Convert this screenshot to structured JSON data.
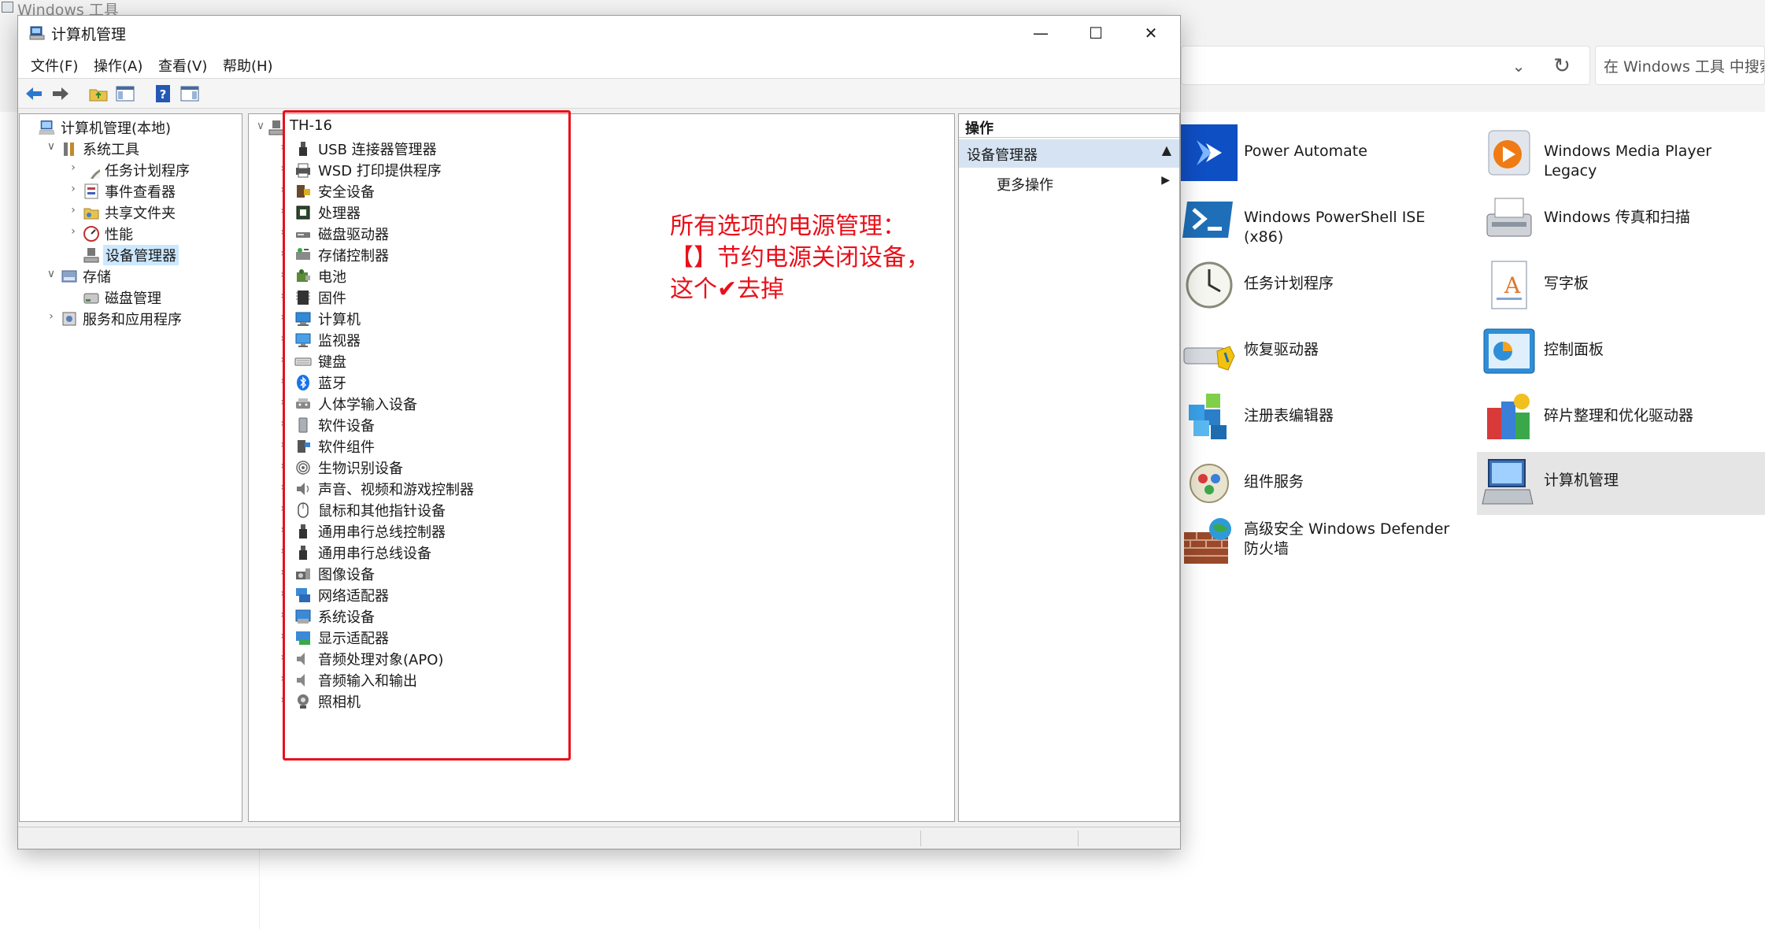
{
  "background_window": {
    "title": "Windows 工具",
    "search_placeholder": "在 Windows 工具 中搜索",
    "tools": [
      {
        "label": "Power Automate",
        "icon": "power-automate-icon"
      },
      {
        "label": "Windows Media Player Legacy",
        "icon": "media-player-icon"
      },
      {
        "label": "Windows PowerShell ISE (x86)",
        "icon": "powershell-icon"
      },
      {
        "label": "Windows 传真和扫描",
        "icon": "fax-scan-icon"
      },
      {
        "label": "任务计划程序",
        "icon": "clock-icon"
      },
      {
        "label": "写字板",
        "icon": "wordpad-icon"
      },
      {
        "label": "恢复驱动器",
        "icon": "recovery-drive-icon"
      },
      {
        "label": "控制面板",
        "icon": "control-panel-icon"
      },
      {
        "label": "注册表编辑器",
        "icon": "registry-icon"
      },
      {
        "label": "碎片整理和优化驱动器",
        "icon": "defrag-icon"
      },
      {
        "label": "组件服务",
        "icon": "component-services-icon"
      },
      {
        "label": "计算机管理",
        "icon": "computer-management-icon",
        "selected": true
      },
      {
        "label": "高级安全 Windows Defender 防火墙",
        "icon": "firewall-icon"
      }
    ]
  },
  "window": {
    "title": "计算机管理",
    "controls": {
      "minimize": "—",
      "maximize": "☐",
      "close": "✕"
    }
  },
  "menu": [
    "文件(F)",
    "操作(A)",
    "查看(V)",
    "帮助(H)"
  ],
  "tree": [
    {
      "label": "计算机管理(本地)",
      "level": 0,
      "twisty": "",
      "icon": "computer-management-icon"
    },
    {
      "label": "系统工具",
      "level": 1,
      "twisty": "∨",
      "icon": "tools-icon"
    },
    {
      "label": "任务计划程序",
      "level": 2,
      "twisty": "›",
      "icon": "clock-icon"
    },
    {
      "label": "事件查看器",
      "level": 2,
      "twisty": "›",
      "icon": "event-viewer-icon"
    },
    {
      "label": "共享文件夹",
      "level": 2,
      "twisty": "›",
      "icon": "shared-folder-icon"
    },
    {
      "label": "性能",
      "level": 2,
      "twisty": "›",
      "icon": "performance-icon"
    },
    {
      "label": "设备管理器",
      "level": 2,
      "twisty": "",
      "icon": "device-manager-icon",
      "selected": true
    },
    {
      "label": "存储",
      "level": 1,
      "twisty": "∨",
      "icon": "storage-icon"
    },
    {
      "label": "磁盘管理",
      "level": 2,
      "twisty": "",
      "icon": "disk-management-icon"
    },
    {
      "label": "服务和应用程序",
      "level": 1,
      "twisty": "›",
      "icon": "services-icon"
    }
  ],
  "devices": {
    "root": "TH-16",
    "categories": [
      {
        "label": "USB 连接器管理器",
        "icon": "usb-icon"
      },
      {
        "label": "WSD 打印提供程序",
        "icon": "printer-icon"
      },
      {
        "label": "安全设备",
        "icon": "security-device-icon"
      },
      {
        "label": "处理器",
        "icon": "processor-icon"
      },
      {
        "label": "磁盘驱动器",
        "icon": "disk-drive-icon"
      },
      {
        "label": "存储控制器",
        "icon": "storage-controller-icon"
      },
      {
        "label": "电池",
        "icon": "battery-icon"
      },
      {
        "label": "固件",
        "icon": "firmware-icon"
      },
      {
        "label": "计算机",
        "icon": "computer-icon"
      },
      {
        "label": "监视器",
        "icon": "monitor-icon"
      },
      {
        "label": "键盘",
        "icon": "keyboard-icon"
      },
      {
        "label": "蓝牙",
        "icon": "bluetooth-icon"
      },
      {
        "label": "人体学输入设备",
        "icon": "hid-icon"
      },
      {
        "label": "软件设备",
        "icon": "software-device-icon"
      },
      {
        "label": "软件组件",
        "icon": "software-component-icon"
      },
      {
        "label": "生物识别设备",
        "icon": "biometric-icon"
      },
      {
        "label": "声音、视频和游戏控制器",
        "icon": "speaker-icon"
      },
      {
        "label": "鼠标和其他指针设备",
        "icon": "mouse-icon"
      },
      {
        "label": "通用串行总线控制器",
        "icon": "usb-controller-icon"
      },
      {
        "label": "通用串行总线设备",
        "icon": "usb-device-icon"
      },
      {
        "label": "图像设备",
        "icon": "imaging-device-icon"
      },
      {
        "label": "网络适配器",
        "icon": "network-adapter-icon"
      },
      {
        "label": "系统设备",
        "icon": "system-device-icon"
      },
      {
        "label": "显示适配器",
        "icon": "display-adapter-icon"
      },
      {
        "label": "音频处理对象(APO)",
        "icon": "audio-apo-icon"
      },
      {
        "label": "音频输入和输出",
        "icon": "audio-io-icon"
      },
      {
        "label": "照相机",
        "icon": "camera-icon"
      }
    ]
  },
  "annotation": {
    "lines": [
      "所有选项的电源管理：",
      "【】节约电源关闭设备，",
      "这个✔去掉"
    ],
    "color": "#e8101a"
  },
  "actions": {
    "header": "操作",
    "section": "设备管理器",
    "section_arrow": "▲",
    "more": "更多操作",
    "more_arrow": "▶"
  }
}
